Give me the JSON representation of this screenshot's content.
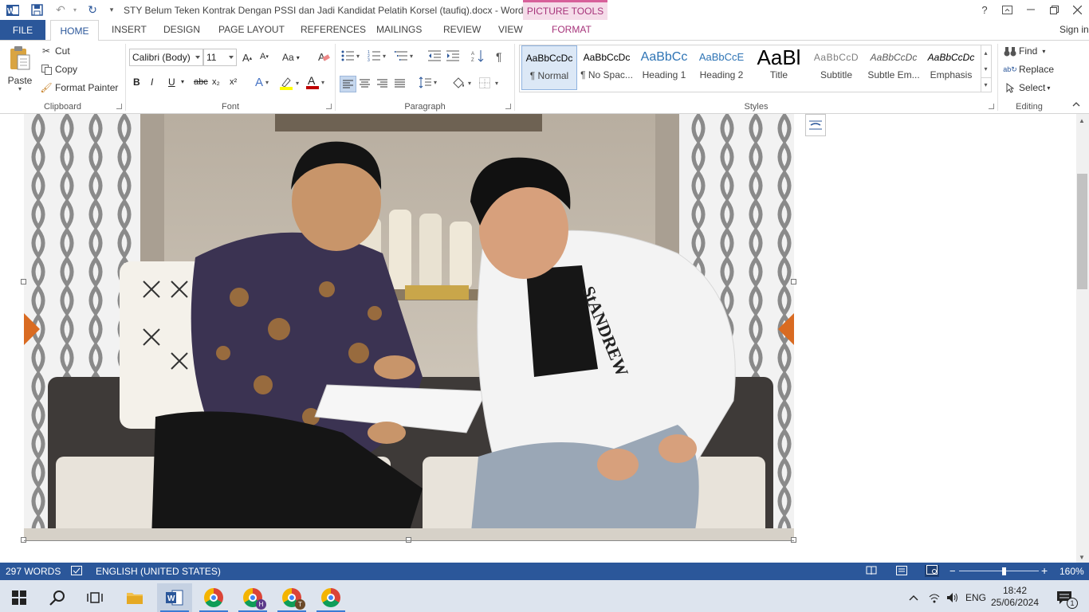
{
  "window": {
    "title": "STY Belum Teken Kontrak Dengan PSSI dan Jadi Kandidat Pelatih Korsel (taufiq).docx - Word (...",
    "picture_tools": "PICTURE TOOLS",
    "help": "?",
    "signin": "Sign in"
  },
  "tabs": {
    "file": "FILE",
    "home": "HOME",
    "insert": "INSERT",
    "design": "DESIGN",
    "page_layout": "PAGE LAYOUT",
    "references": "REFERENCES",
    "mailings": "MAILINGS",
    "review": "REVIEW",
    "view": "VIEW",
    "format": "FORMAT"
  },
  "clipboard": {
    "paste": "Paste",
    "cut": "Cut",
    "copy": "Copy",
    "format_painter": "Format Painter",
    "label": "Clipboard"
  },
  "font": {
    "name": "Calibri (Body)",
    "size": "11",
    "change_case": "Aa",
    "bold": "B",
    "italic": "I",
    "underline": "U",
    "strike": "abc",
    "superscript": "x²",
    "label": "Font"
  },
  "paragraph": {
    "label": "Paragraph",
    "pilcrow": "¶"
  },
  "styles": {
    "label": "Styles",
    "items": [
      {
        "preview": "AaBbCcDc",
        "name": "¶ Normal"
      },
      {
        "preview": "AaBbCcDc",
        "name": "¶ No Spac..."
      },
      {
        "preview": "AaBbCc",
        "name": "Heading 1"
      },
      {
        "preview": "AaBbCcE",
        "name": "Heading 2"
      },
      {
        "preview": "AaBl",
        "name": "Title"
      },
      {
        "preview": "AaBbCcD",
        "name": "Subtitle"
      },
      {
        "preview": "AaBbCcDc",
        "name": "Subtle Em..."
      },
      {
        "preview": "AaBbCcDc",
        "name": "Emphasis"
      }
    ]
  },
  "editing": {
    "find": "Find",
    "replace": "Replace",
    "select": "Select",
    "label": "Editing"
  },
  "photo": {
    "jersey_text": "StANDREW"
  },
  "status": {
    "words": "297 WORDS",
    "language": "ENGLISH (UNITED STATES)",
    "zoom": "160%",
    "zoom_fraction": 0.6
  },
  "taskbar": {
    "lang": "ENG",
    "time": "18:42",
    "date": "25/06/2024",
    "notif_count": "1",
    "chrome_h": "H",
    "chrome_t": "T"
  },
  "colors": {
    "accent": "#2b579a",
    "picture_tools_bg": "#f5dce9",
    "picture_tools_text": "#a6337a"
  }
}
